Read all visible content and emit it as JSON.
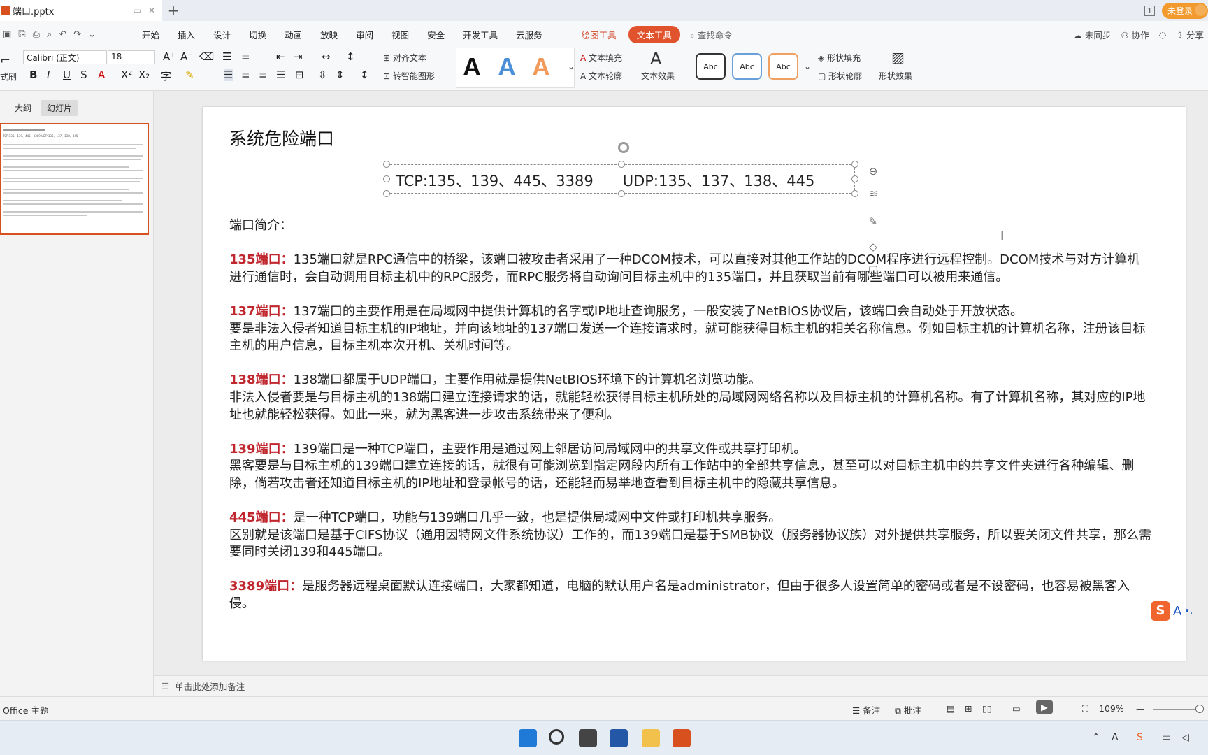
{
  "titlebar": {
    "tab_name": "端口.pptx",
    "win_count": "1",
    "login_label": "未登录"
  },
  "menubar": {
    "items": [
      "开始",
      "插入",
      "设计",
      "切换",
      "动画",
      "放映",
      "审阅",
      "视图",
      "安全",
      "开发工具",
      "云服务"
    ],
    "context_tools": [
      "绘图工具",
      "文本工具"
    ],
    "search_label": "查找命令",
    "right": [
      "未同步",
      "协作",
      "分享"
    ]
  },
  "ribbon": {
    "format_painter": "式刷",
    "font_name": "Calibri (正文)",
    "font_size": "18",
    "align_text": "对齐文本",
    "smartart": "转智能图形",
    "text_fill": "文本填充",
    "text_outline": "文本轮廓",
    "text_effect": "文本效果",
    "shape_fill": "形状填充",
    "shape_outline": "形状轮廓",
    "shape_effect": "形状效果",
    "style_sample": "Abc",
    "big_a": "A"
  },
  "leftpanel": {
    "tab_outline": "大纲",
    "tab_slides": "幻灯片",
    "thumb_line": "TCP:135、139、445、3389     UDP:135、137、138、445"
  },
  "slide": {
    "title": "系统危险端口",
    "tcp": "TCP:135、139、445、3389",
    "udp": "UDP:135、137、138、445",
    "intro": "端口简介：",
    "sections": [
      {
        "label": "135端口：",
        "text": "135端口就是RPC通信中的桥梁，该端口被攻击者采用了一种DCOM技术，可以直接对其他工作站的DCOM程序进行远程控制。DCOM技术与对方计算机进行通信时，会自动调用目标主机中的RPC服务，而RPC服务将自动询问目标主机中的135端口，并且获取当前有哪些端口可以被用来通信。",
        "extra": ""
      },
      {
        "label": "137端口：",
        "text": "137端口的主要作用是在局域网中提供计算机的名字或IP地址查询服务，一般安装了NetBIOS协议后，该端口会自动处于开放状态。",
        "extra": "要是非法入侵者知道目标主机的IP地址，并向该地址的137端口发送一个连接请求时，就可能获得目标主机的相关名称信息。例如目标主机的计算机名称，注册该目标主机的用户信息，目标主机本次开机、关机时间等。"
      },
      {
        "label": "138端口：",
        "text": "138端口都属于UDP端口，主要作用就是提供NetBIOS环境下的计算机名浏览功能。",
        "extra": "非法入侵者要是与目标主机的138端口建立连接请求的话，就能轻松获得目标主机所处的局域网网络名称以及目标主机的计算机名称。有了计算机名称，其对应的IP地址也就能轻松获得。如此一来，就为黑客进一步攻击系统带来了便利。"
      },
      {
        "label": "139端口：",
        "text": "139端口是一种TCP端口，主要作用是通过网上邻居访问局域网中的共享文件或共享打印机。",
        "extra": "黑客要是与目标主机的139端口建立连接的话，就很有可能浏览到指定网段内所有工作站中的全部共享信息，甚至可以对目标主机中的共享文件夹进行各种编辑、删除，倘若攻击者还知道目标主机的IP地址和登录帐号的话，还能轻而易举地查看到目标主机中的隐藏共享信息。"
      },
      {
        "label": "445端口：",
        "text": "是一种TCP端口，功能与139端口几乎一致，也是提供局域网中文件或打印机共享服务。",
        "extra": "区别就是该端口是基于CIFS协议（通用因特网文件系统协议）工作的，而139端口是基于SMB协议（服务器协议族）对外提供共享服务，所以要关闭文件共享，那么需要同时关闭139和445端口。"
      },
      {
        "label": "3389端口：",
        "text": "是服务器远程桌面默认连接端口，大家都知道，电脑的默认用户名是administrator，但由于很多人设置简单的密码或者是不设密码，也容易被黑客入侵。",
        "extra": ""
      }
    ]
  },
  "notes": {
    "placeholder": "单击此处添加备注"
  },
  "statusbar": {
    "theme": "Office 主题",
    "notes_label": "备注",
    "comments_label": "批注",
    "zoom": "109%"
  },
  "sogou": {
    "label": "A"
  },
  "colors": {
    "accent": "#e0532c",
    "port_label": "#c0262d"
  }
}
